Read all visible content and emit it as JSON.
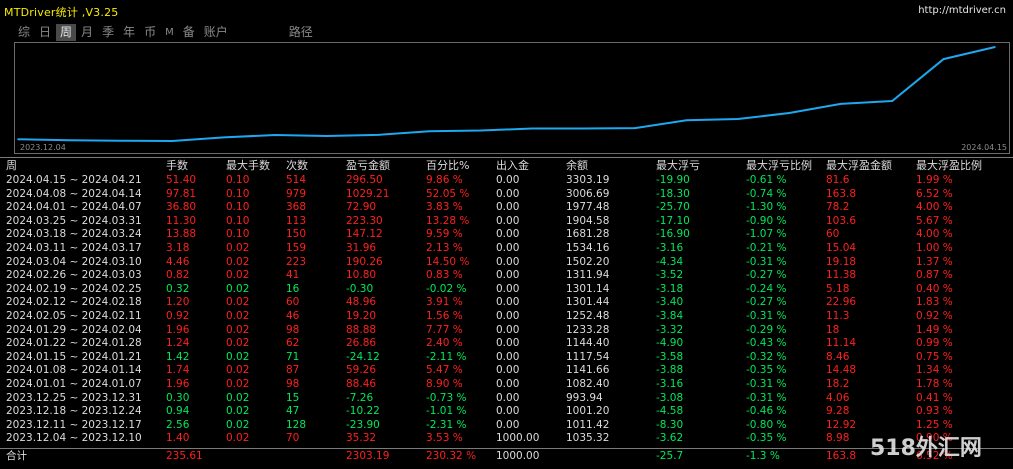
{
  "titlebar": {
    "title": "MTDriver统计 ,V3.25",
    "url": "http://mtdriver.cn"
  },
  "tabs": [
    "综",
    "日",
    "周",
    "月",
    "季",
    "年",
    "币",
    "M",
    "备",
    "账户",
    "路径"
  ],
  "active_tab": "周",
  "chart": {
    "date_start": "2023.12.04",
    "date_end": "2024.04.15",
    "line_color": "#1ea8f0",
    "balances": [
      1035.32,
      1011.42,
      1001.2,
      993.94,
      1082.4,
      1141.66,
      1117.54,
      1144.4,
      1233.28,
      1252.48,
      1301.44,
      1301.14,
      1311.94,
      1502.2,
      1534.16,
      1681.28,
      1904.58,
      1977.48,
      3006.69,
      3303.19
    ]
  },
  "table": {
    "headers": [
      "周",
      "手数",
      "最大手数",
      "次数",
      "盈亏金额",
      "百分比%",
      "出入金",
      "余额",
      "最大浮亏",
      "最大浮亏比例",
      "最大浮盈金额",
      "最大浮盈比例"
    ],
    "rows": [
      {
        "period": "2024.04.15 ~ 2024.04.21",
        "lots": "51.40",
        "maxlots": "0.10",
        "count": "514",
        "pnl": "296.50",
        "pct": "9.86 %",
        "flow": "0.00",
        "balance": "3303.19",
        "dd": "-19.90",
        "ddpct": "-0.61 %",
        "fp": "81.6",
        "fppct": "1.99 %",
        "color": "red"
      },
      {
        "period": "2024.04.08 ~ 2024.04.14",
        "lots": "97.81",
        "maxlots": "0.10",
        "count": "979",
        "pnl": "1029.21",
        "pct": "52.05 %",
        "flow": "0.00",
        "balance": "3006.69",
        "dd": "-18.30",
        "ddpct": "-0.74 %",
        "fp": "163.8",
        "fppct": "6.52 %",
        "color": "red"
      },
      {
        "period": "2024.04.01 ~ 2024.04.07",
        "lots": "36.80",
        "maxlots": "0.10",
        "count": "368",
        "pnl": "72.90",
        "pct": "3.83 %",
        "flow": "0.00",
        "balance": "1977.48",
        "dd": "-25.70",
        "ddpct": "-1.30 %",
        "fp": "78.2",
        "fppct": "4.00 %",
        "color": "red"
      },
      {
        "period": "2024.03.25 ~ 2024.03.31",
        "lots": "11.30",
        "maxlots": "0.10",
        "count": "113",
        "pnl": "223.30",
        "pct": "13.28 %",
        "flow": "0.00",
        "balance": "1904.58",
        "dd": "-17.10",
        "ddpct": "-0.90 %",
        "fp": "103.6",
        "fppct": "5.67 %",
        "color": "red"
      },
      {
        "period": "2024.03.18 ~ 2024.03.24",
        "lots": "13.88",
        "maxlots": "0.10",
        "count": "150",
        "pnl": "147.12",
        "pct": "9.59 %",
        "flow": "0.00",
        "balance": "1681.28",
        "dd": "-16.90",
        "ddpct": "-1.07 %",
        "fp": "60",
        "fppct": "4.00 %",
        "color": "red"
      },
      {
        "period": "2024.03.11 ~ 2024.03.17",
        "lots": "3.18",
        "maxlots": "0.02",
        "count": "159",
        "pnl": "31.96",
        "pct": "2.13 %",
        "flow": "0.00",
        "balance": "1534.16",
        "dd": "-3.16",
        "ddpct": "-0.21 %",
        "fp": "15.04",
        "fppct": "1.00 %",
        "color": "red"
      },
      {
        "period": "2024.03.04 ~ 2024.03.10",
        "lots": "4.46",
        "maxlots": "0.02",
        "count": "223",
        "pnl": "190.26",
        "pct": "14.50 %",
        "flow": "0.00",
        "balance": "1502.20",
        "dd": "-4.34",
        "ddpct": "-0.31 %",
        "fp": "19.18",
        "fppct": "1.37 %",
        "color": "red"
      },
      {
        "period": "2024.02.26 ~ 2024.03.03",
        "lots": "0.82",
        "maxlots": "0.02",
        "count": "41",
        "pnl": "10.80",
        "pct": "0.83 %",
        "flow": "0.00",
        "balance": "1311.94",
        "dd": "-3.52",
        "ddpct": "-0.27 %",
        "fp": "11.38",
        "fppct": "0.87 %",
        "color": "red"
      },
      {
        "period": "2024.02.19 ~ 2024.02.25",
        "lots": "0.32",
        "maxlots": "0.02",
        "count": "16",
        "pnl": "-0.30",
        "pct": "-0.02 %",
        "flow": "0.00",
        "balance": "1301.14",
        "dd": "-3.18",
        "ddpct": "-0.24 %",
        "fp": "5.18",
        "fppct": "0.40 %",
        "color": "green"
      },
      {
        "period": "2024.02.12 ~ 2024.02.18",
        "lots": "1.20",
        "maxlots": "0.02",
        "count": "60",
        "pnl": "48.96",
        "pct": "3.91 %",
        "flow": "0.00",
        "balance": "1301.44",
        "dd": "-3.40",
        "ddpct": "-0.27 %",
        "fp": "22.96",
        "fppct": "1.83 %",
        "color": "red"
      },
      {
        "period": "2024.02.05 ~ 2024.02.11",
        "lots": "0.92",
        "maxlots": "0.02",
        "count": "46",
        "pnl": "19.20",
        "pct": "1.56 %",
        "flow": "0.00",
        "balance": "1252.48",
        "dd": "-3.84",
        "ddpct": "-0.31 %",
        "fp": "11.3",
        "fppct": "0.92 %",
        "color": "red"
      },
      {
        "period": "2024.01.29 ~ 2024.02.04",
        "lots": "1.96",
        "maxlots": "0.02",
        "count": "98",
        "pnl": "88.88",
        "pct": "7.77 %",
        "flow": "0.00",
        "balance": "1233.28",
        "dd": "-3.32",
        "ddpct": "-0.29 %",
        "fp": "18",
        "fppct": "1.49 %",
        "color": "red"
      },
      {
        "period": "2024.01.22 ~ 2024.01.28",
        "lots": "1.24",
        "maxlots": "0.02",
        "count": "62",
        "pnl": "26.86",
        "pct": "2.40 %",
        "flow": "0.00",
        "balance": "1144.40",
        "dd": "-4.90",
        "ddpct": "-0.43 %",
        "fp": "11.14",
        "fppct": "0.99 %",
        "color": "red"
      },
      {
        "period": "2024.01.15 ~ 2024.01.21",
        "lots": "1.42",
        "maxlots": "0.02",
        "count": "71",
        "pnl": "-24.12",
        "pct": "-2.11 %",
        "flow": "0.00",
        "balance": "1117.54",
        "dd": "-3.58",
        "ddpct": "-0.32 %",
        "fp": "8.46",
        "fppct": "0.75 %",
        "color": "green"
      },
      {
        "period": "2024.01.08 ~ 2024.01.14",
        "lots": "1.74",
        "maxlots": "0.02",
        "count": "87",
        "pnl": "59.26",
        "pct": "5.47 %",
        "flow": "0.00",
        "balance": "1141.66",
        "dd": "-3.88",
        "ddpct": "-0.35 %",
        "fp": "14.48",
        "fppct": "1.34 %",
        "color": "red"
      },
      {
        "period": "2024.01.01 ~ 2024.01.07",
        "lots": "1.96",
        "maxlots": "0.02",
        "count": "98",
        "pnl": "88.46",
        "pct": "8.90 %",
        "flow": "0.00",
        "balance": "1082.40",
        "dd": "-3.16",
        "ddpct": "-0.31 %",
        "fp": "18.2",
        "fppct": "1.78 %",
        "color": "red"
      },
      {
        "period": "2023.12.25 ~ 2023.12.31",
        "lots": "0.30",
        "maxlots": "0.02",
        "count": "15",
        "pnl": "-7.26",
        "pct": "-0.73 %",
        "flow": "0.00",
        "balance": "993.94",
        "dd": "-3.08",
        "ddpct": "-0.31 %",
        "fp": "4.06",
        "fppct": "0.41 %",
        "color": "green"
      },
      {
        "period": "2023.12.18 ~ 2023.12.24",
        "lots": "0.94",
        "maxlots": "0.02",
        "count": "47",
        "pnl": "-10.22",
        "pct": "-1.01 %",
        "flow": "0.00",
        "balance": "1001.20",
        "dd": "-4.58",
        "ddpct": "-0.46 %",
        "fp": "9.28",
        "fppct": "0.93 %",
        "color": "green"
      },
      {
        "period": "2023.12.11 ~ 2023.12.17",
        "lots": "2.56",
        "maxlots": "0.02",
        "count": "128",
        "pnl": "-23.90",
        "pct": "-2.31 %",
        "flow": "0.00",
        "balance": "1011.42",
        "dd": "-8.30",
        "ddpct": "-0.80 %",
        "fp": "12.92",
        "fppct": "1.25 %",
        "color": "green"
      },
      {
        "period": "2023.12.04 ~ 2023.12.10",
        "lots": "1.40",
        "maxlots": "0.02",
        "count": "70",
        "pnl": "35.32",
        "pct": "3.53 %",
        "flow": "1000.00",
        "balance": "1035.32",
        "dd": "-3.62",
        "ddpct": "-0.35 %",
        "fp": "8.98",
        "fppct": "0.90 %",
        "color": "red"
      }
    ],
    "summary": {
      "period": "合计",
      "lots": "235.61",
      "maxlots": "",
      "count": "",
      "pnl": "2303.19",
      "pct": "230.32 %",
      "flow": "1000.00",
      "balance": "",
      "dd": "-25.7",
      "ddpct": "-1.3 %",
      "fp": "163.8",
      "fppct": "6.52 %"
    }
  },
  "watermark": "518外汇网"
}
